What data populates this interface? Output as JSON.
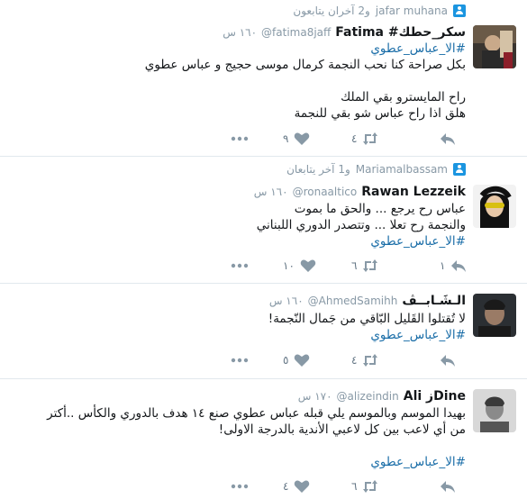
{
  "tweets": [
    {
      "context": {
        "name": "jafar muhana",
        "text": "و2 آخران يتابعون"
      },
      "fullname": "Fatima #سكر_حطك",
      "handle": "@fatima8jaff",
      "time": "١٦٠ س",
      "lines": [
        "#الا_عباس_عطوي",
        "بكل صراحة كنا نحب النجمة كرمال موسى حجيج و عباس عطوي",
        "",
        "راح المايسترو بقي الملك",
        "هلق اذا راح عباس شو بقي للنجمة"
      ],
      "hashtag_line_index": 0,
      "retweets": "٤",
      "likes": "٩"
    },
    {
      "context": {
        "name": "Mariamalbassam",
        "text": "و1 آخر يتابعان"
      },
      "fullname": "Rawan Lezzeik",
      "handle": "@ronaaltico",
      "time": "١٦٠ س",
      "lines": [
        "عباس رح يرجع ... والحق ما بموت",
        "والنجمة رح تعلا ... وتتصدر  الدوري اللبناني",
        "#الا_عباس_عطوي"
      ],
      "hashtag_line_index": 2,
      "replies": "١",
      "retweets": "٦",
      "likes": "١٠"
    },
    {
      "fullname": "الـشَـابــڤ",
      "handle": "@AhmedSamihh",
      "time": "١٦٠ س",
      "lines": [
        "لا تُقتلوا القَليل البّاقي من جَمال النّجمة!",
        "#الا_عباس_عطوي"
      ],
      "hashtag_line_index": 1,
      "retweets": "٤",
      "likes": "٥"
    },
    {
      "fullname": "Ali زDine",
      "handle": "@alizeindin",
      "time": "١٧٠ س",
      "lines": [
        "بهيدا الموسم وبالموسم يلي قبله عباس عطوي صنع ١٤ هدف بالدوري والكأس ..أكتر",
        "من أي لاعب بين كل لاعبي الأندية بالدرجة الاولى!",
        "",
        "#الا_عباس_عطوي"
      ],
      "hashtag_line_index": 3,
      "retweets": "٦",
      "likes": "٤"
    }
  ]
}
